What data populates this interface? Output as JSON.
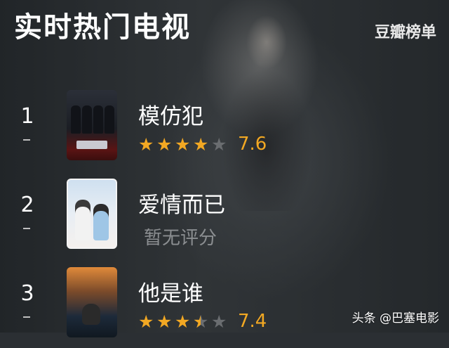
{
  "header": {
    "title": "实时热门电视",
    "brand": "豆瓣榜单"
  },
  "items": [
    {
      "rank": "1",
      "name": "模仿犯",
      "stars": 4,
      "score": "7.6"
    },
    {
      "rank": "2",
      "name": "爱情而已",
      "rating_text": "暂无评分"
    },
    {
      "rank": "3",
      "name": "他是谁",
      "stars": 3.5,
      "score": "7.4"
    }
  ],
  "watermark": "头条 @巴塞电影",
  "colors": {
    "star": "#f2a823",
    "text": "#ffffff",
    "muted": "#8b8e91"
  }
}
